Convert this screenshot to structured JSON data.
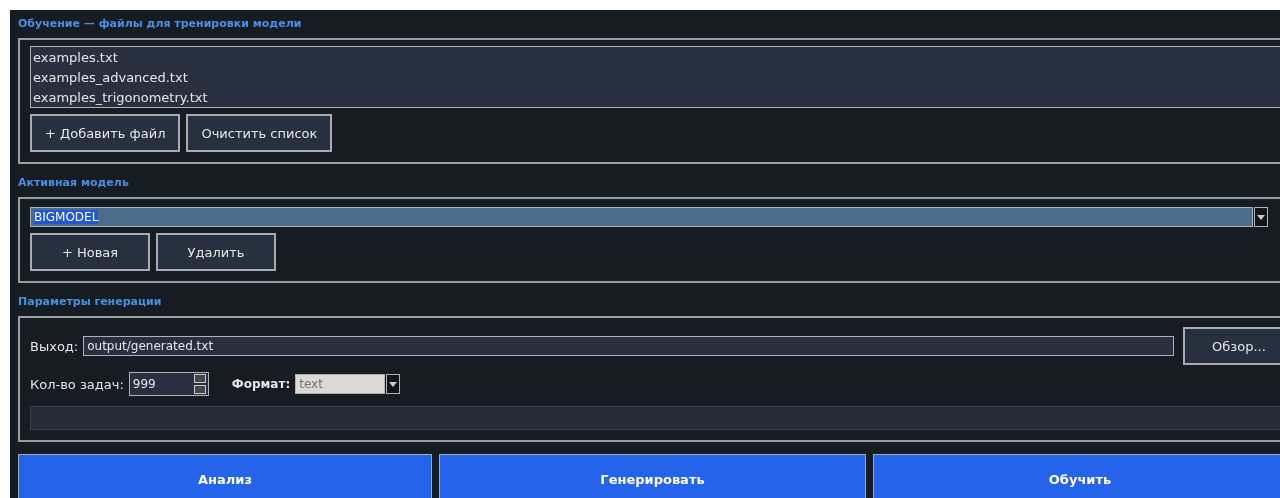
{
  "training": {
    "title": "Обучение — файлы для тренировки модели",
    "files": [
      "examples.txt",
      "examples_advanced.txt",
      "examples_trigonometry.txt"
    ],
    "buttons": [
      "+ Добавить файл",
      "Очистить список"
    ]
  },
  "model": {
    "title": "Активная модель",
    "value": "BIGMODEL",
    "highlighted": true,
    "buttons": [
      "+ Новая",
      "Удалить"
    ]
  },
  "generation": {
    "title": "Параметры генерации",
    "output_label": "Выход:",
    "output_value": "output/generated.txt",
    "browse_button": "Обзор...",
    "count_label": "Кол-во задач:",
    "count_value": "999",
    "format_label": "Формат:",
    "format_value": "text",
    "format_disabled": true,
    "progress": {
      "level": 0
    }
  },
  "actions": [
    "Анализ",
    "Генерировать",
    "Обучить"
  ]
}
